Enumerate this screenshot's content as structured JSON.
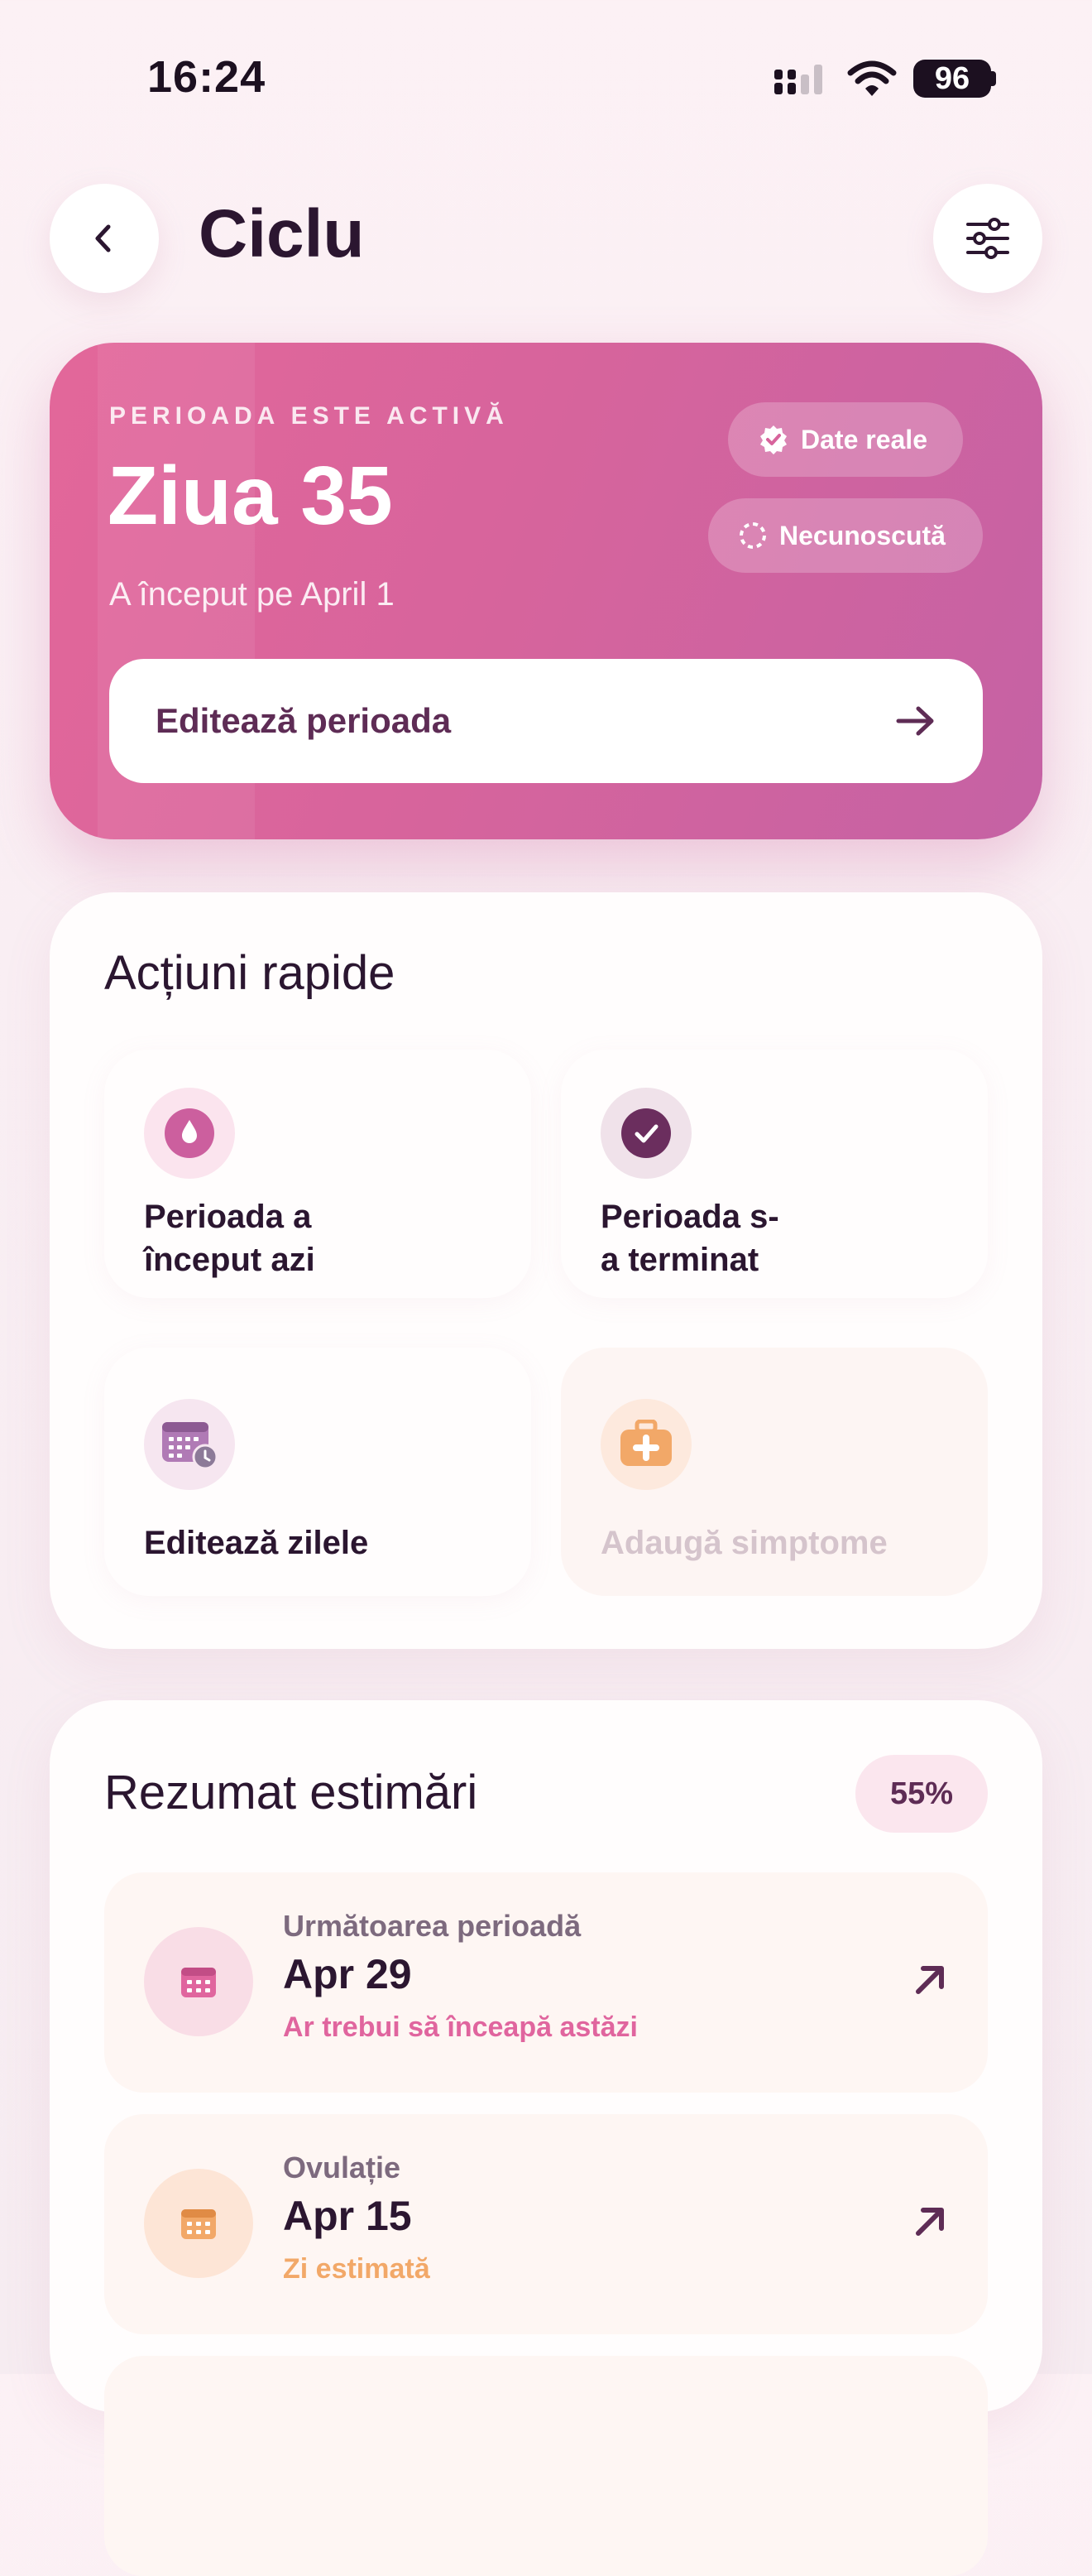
{
  "status_bar": {
    "time": "16:24",
    "battery": "96"
  },
  "header": {
    "title": "Ciclu"
  },
  "hero": {
    "eyebrow": "PERIOADA ESTE ACTIVĂ",
    "day": "Ziua 35",
    "started": "A început pe April 1",
    "badge_real": "Date reale",
    "badge_unknown": "Necunoscută",
    "edit_label": "Editează perioada"
  },
  "quick_actions": {
    "title": "Acțiuni rapide",
    "items": [
      {
        "label_line1": "Perioada a",
        "label_line2": "început azi",
        "icon": "drop-icon",
        "color": "#cc5f9e"
      },
      {
        "label_line1": "Perioada s-",
        "label_line2": "a terminat",
        "icon": "check-icon",
        "color": "#6b2e5e"
      },
      {
        "label_line1": "Editează zilele",
        "label_line2": "",
        "icon": "calendar-edit-icon",
        "color": "#b07ab5"
      },
      {
        "label_line1": "Adaugă simptome",
        "label_line2": "",
        "icon": "medkit-icon",
        "color": "#f2a868",
        "disabled": true
      }
    ]
  },
  "estimates": {
    "title": "Rezumat estimări",
    "confidence": "55%",
    "rows": [
      {
        "label": "Următoarea perioadă",
        "date": "Apr 29",
        "note": "Ar trebui să înceapă astăzi",
        "note_color": "#e0659e",
        "icon": "calendar-icon"
      },
      {
        "label": "Ovulație",
        "date": "Apr 15",
        "note": "Zi estimată",
        "note_color": "#f2a868",
        "icon": "calendar-icon"
      }
    ]
  },
  "colors": {
    "accent": "#d7649c",
    "brand_dark": "#5e2c55",
    "text": "#2b1630"
  }
}
